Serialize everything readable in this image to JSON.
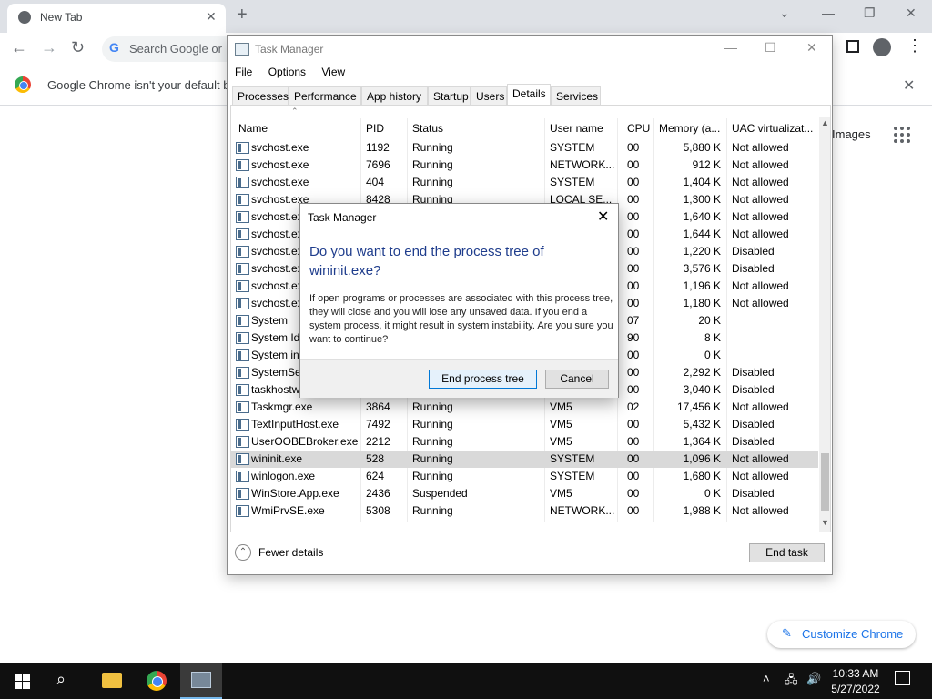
{
  "browser": {
    "tab_title": "New Tab",
    "omnibox_placeholder": "Search Google or",
    "infobar_message": "Google Chrome isn't your default b",
    "images_link": "Images",
    "customize_label": "Customize Chrome"
  },
  "task_manager": {
    "title": "Task Manager",
    "menu": [
      "File",
      "Options",
      "View"
    ],
    "tabs": [
      "Processes",
      "Performance",
      "App history",
      "Startup",
      "Users",
      "Details",
      "Services"
    ],
    "selected_tab": "Details",
    "columns": [
      "Name",
      "PID",
      "Status",
      "User name",
      "CPU",
      "Memory (a...",
      "UAC virtualizat..."
    ],
    "rows": [
      {
        "name": "svchost.exe",
        "pid": "1192",
        "status": "Running",
        "user": "SYSTEM",
        "cpu": "00",
        "mem": "5,880 K",
        "uac": "Not allowed"
      },
      {
        "name": "svchost.exe",
        "pid": "7696",
        "status": "Running",
        "user": "NETWORK...",
        "cpu": "00",
        "mem": "912 K",
        "uac": "Not allowed"
      },
      {
        "name": "svchost.exe",
        "pid": "404",
        "status": "Running",
        "user": "SYSTEM",
        "cpu": "00",
        "mem": "1,404 K",
        "uac": "Not allowed"
      },
      {
        "name": "svchost.exe",
        "pid": "8428",
        "status": "Running",
        "user": "LOCAL SE...",
        "cpu": "00",
        "mem": "1,300 K",
        "uac": "Not allowed"
      },
      {
        "name": "svchost.exe",
        "pid": "",
        "status": "",
        "user": "",
        "cpu": "00",
        "mem": "1,640 K",
        "uac": "Not allowed"
      },
      {
        "name": "svchost.exe",
        "pid": "",
        "status": "",
        "user": "",
        "cpu": "00",
        "mem": "1,644 K",
        "uac": "Not allowed"
      },
      {
        "name": "svchost.exe",
        "pid": "",
        "status": "",
        "user": "",
        "cpu": "00",
        "mem": "1,220 K",
        "uac": "Disabled"
      },
      {
        "name": "svchost.exe",
        "pid": "",
        "status": "",
        "user": "",
        "cpu": "00",
        "mem": "3,576 K",
        "uac": "Disabled"
      },
      {
        "name": "svchost.exe",
        "pid": "",
        "status": "",
        "user": "",
        "cpu": "00",
        "mem": "1,196 K",
        "uac": "Not allowed"
      },
      {
        "name": "svchost.exe",
        "pid": "",
        "status": "",
        "user": "",
        "cpu": "00",
        "mem": "1,180 K",
        "uac": "Not allowed"
      },
      {
        "name": "System",
        "pid": "",
        "status": "",
        "user": "",
        "cpu": "07",
        "mem": "20 K",
        "uac": ""
      },
      {
        "name": "System Idle",
        "pid": "",
        "status": "",
        "user": "",
        "cpu": "90",
        "mem": "8 K",
        "uac": ""
      },
      {
        "name": "System int",
        "pid": "",
        "status": "",
        "user": "",
        "cpu": "00",
        "mem": "0 K",
        "uac": ""
      },
      {
        "name": "SystemSett",
        "pid": "",
        "status": "",
        "user": "",
        "cpu": "00",
        "mem": "2,292 K",
        "uac": "Disabled"
      },
      {
        "name": "taskhostw.",
        "pid": "",
        "status": "",
        "user": "",
        "cpu": "00",
        "mem": "3,040 K",
        "uac": "Disabled"
      },
      {
        "name": "Taskmgr.exe",
        "pid": "3864",
        "status": "Running",
        "user": "VM5",
        "cpu": "02",
        "mem": "17,456 K",
        "uac": "Not allowed"
      },
      {
        "name": "TextInputHost.exe",
        "pid": "7492",
        "status": "Running",
        "user": "VM5",
        "cpu": "00",
        "mem": "5,432 K",
        "uac": "Disabled"
      },
      {
        "name": "UserOOBEBroker.exe",
        "pid": "2212",
        "status": "Running",
        "user": "VM5",
        "cpu": "00",
        "mem": "1,364 K",
        "uac": "Disabled"
      },
      {
        "name": "wininit.exe",
        "pid": "528",
        "status": "Running",
        "user": "SYSTEM",
        "cpu": "00",
        "mem": "1,096 K",
        "uac": "Not allowed"
      },
      {
        "name": "winlogon.exe",
        "pid": "624",
        "status": "Running",
        "user": "SYSTEM",
        "cpu": "00",
        "mem": "1,680 K",
        "uac": "Not allowed"
      },
      {
        "name": "WinStore.App.exe",
        "pid": "2436",
        "status": "Suspended",
        "user": "VM5",
        "cpu": "00",
        "mem": "0 K",
        "uac": "Disabled"
      },
      {
        "name": "WmiPrvSE.exe",
        "pid": "5308",
        "status": "Running",
        "user": "NETWORK...",
        "cpu": "00",
        "mem": "1,988 K",
        "uac": "Not allowed"
      }
    ],
    "selected_row": "wininit.exe",
    "fewer_details": "Fewer details",
    "end_task": "End task"
  },
  "dialog": {
    "title": "Task Manager",
    "question": "Do you want to end the process tree of wininit.exe?",
    "body": "If open programs or processes are associated with this process tree, they will close and you will lose any unsaved data. If you end a system process, it might result in system instability. Are you sure you want to continue?",
    "confirm_label": "End process tree",
    "cancel_label": "Cancel"
  },
  "taskbar": {
    "time": "10:33 AM",
    "date": "5/27/2022"
  },
  "colors": {
    "dialog_heading": "#1e3c8c",
    "primary_button_border": "#0078d7",
    "selection": "#d9d9d9",
    "taskbar": "#101010"
  },
  "icons": [
    "chrome-icon",
    "close-icon",
    "new-tab-icon",
    "back-icon",
    "forward-icon",
    "reload-icon",
    "google-g-icon",
    "sidebar-icon",
    "profile-icon",
    "menu-dots-icon",
    "apps-grid-icon",
    "pencil-icon",
    "task-manager-icon",
    "process-icon",
    "windows-start-icon",
    "search-icon",
    "folder-icon",
    "network-icon",
    "volume-icon",
    "notification-icon"
  ]
}
